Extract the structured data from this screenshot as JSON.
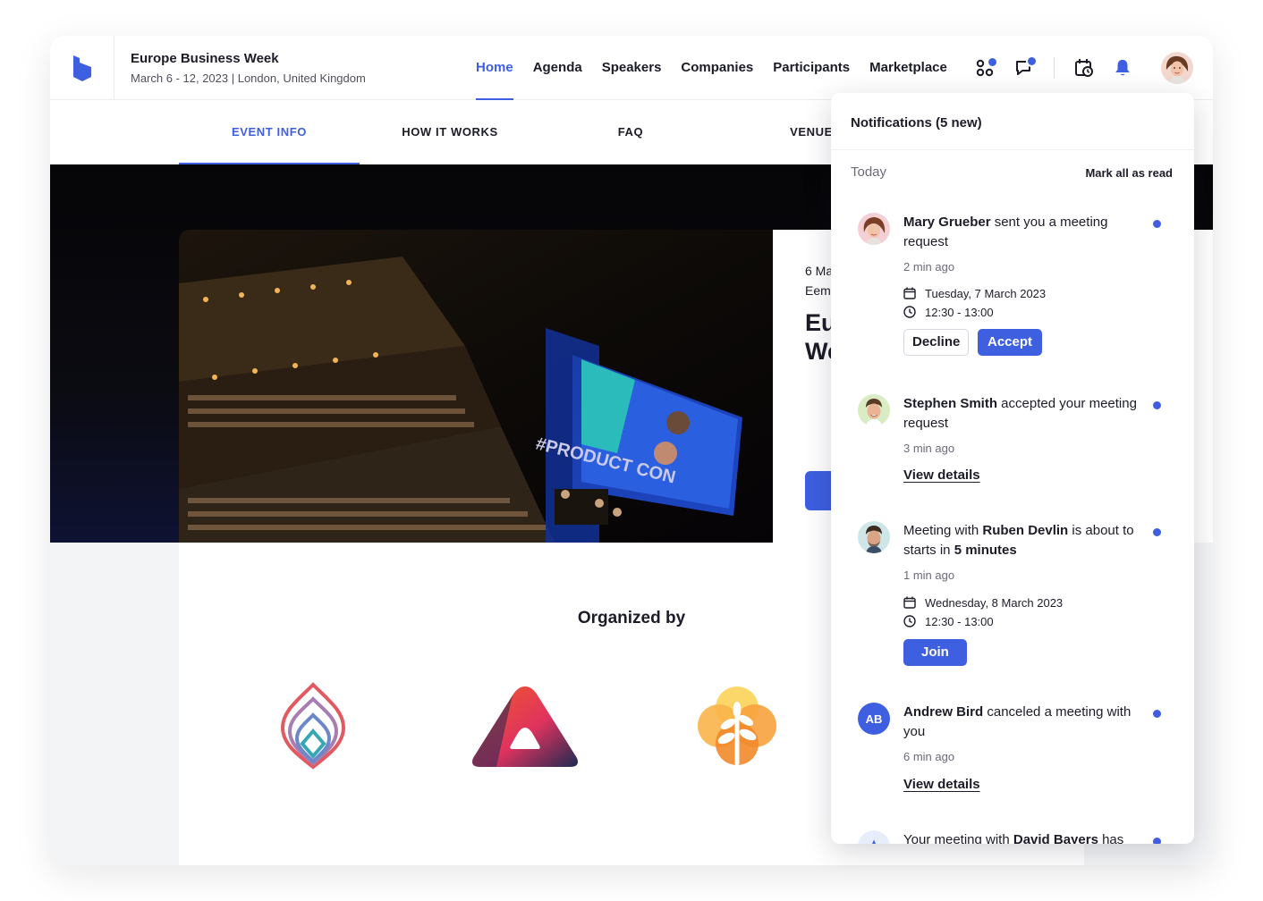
{
  "event": {
    "title": "Europe Business Week",
    "subtitle": "March 6 - 12, 2023 | London, United Kingdom"
  },
  "nav": {
    "items": [
      {
        "label": "Home",
        "active": true
      },
      {
        "label": "Agenda"
      },
      {
        "label": "Speakers"
      },
      {
        "label": "Companies"
      },
      {
        "label": "Participants"
      },
      {
        "label": "Marketplace"
      }
    ],
    "icons": [
      "apps-icon",
      "chat-icon",
      "calendar-clock-icon",
      "bell-icon"
    ]
  },
  "tabs": [
    "EVENT INFO",
    "HOW IT WORKS",
    "FAQ",
    "VENUE"
  ],
  "hero": {
    "date_fragment": "6 Ma",
    "place_fragment": "Eem",
    "title_line1": "Eu",
    "title_line2": "We",
    "screen_text": "#PRODUCT CON"
  },
  "organizers": {
    "title": "Organized by",
    "logos": [
      "diamond-logo",
      "triangle-logo",
      "tree-logo"
    ]
  },
  "notifications": {
    "header": "Notifications (5 new)",
    "group": "Today",
    "mark_all": "Mark all as read",
    "items": [
      {
        "name": "Mary Grueber",
        "text": " sent you a meeting request",
        "time": "2 min ago",
        "date": "Tuesday, 7 March 2023",
        "hours": "12:30 - 13:00",
        "decline": "Decline",
        "accept": "Accept"
      },
      {
        "name": "Stephen Smith",
        "text": " accepted your meeting request",
        "time": "3 min ago",
        "link": "View details"
      },
      {
        "prefix": "Meeting with ",
        "name": "Ruben Devlin",
        "text": " is about to starts in ",
        "emph": "5 minutes",
        "time": "1 min ago",
        "date": "Wednesday, 8 March 2023",
        "hours": "12:30 - 13:00",
        "join": "Join"
      },
      {
        "initials": "AB",
        "name": "Andrew Bird",
        "text": " canceled a meeting with you",
        "time": "6 min ago",
        "link": "View details"
      },
      {
        "prefix": "Your meeting with ",
        "name": "David Bayers",
        "text": " has"
      }
    ]
  },
  "colors": {
    "accent": "#3d5fe0",
    "text": "#1c1c28",
    "muted": "#6b6b78"
  }
}
